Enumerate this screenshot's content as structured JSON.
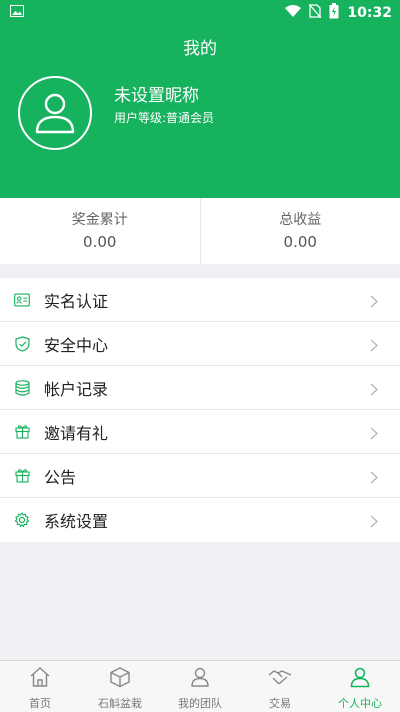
{
  "status_bar": {
    "time": "10:32"
  },
  "header": {
    "title": "我的",
    "nickname": "未设置昵称",
    "level": "用户等级:普通会员"
  },
  "stats": [
    {
      "label": "奖金累计",
      "value": "0.00"
    },
    {
      "label": "总收益",
      "value": "0.00"
    }
  ],
  "menu": [
    {
      "label": "实名认证",
      "icon": "id-card-icon"
    },
    {
      "label": "安全中心",
      "icon": "shield-icon"
    },
    {
      "label": "帐户记录",
      "icon": "database-icon"
    },
    {
      "label": "邀请有礼",
      "icon": "gift-icon"
    },
    {
      "label": "公告",
      "icon": "gift-icon"
    },
    {
      "label": "系统设置",
      "icon": "gear-icon"
    }
  ],
  "tabs": [
    {
      "label": "首页",
      "icon": "home-icon"
    },
    {
      "label": "石斛盆栽",
      "icon": "box-icon"
    },
    {
      "label": "我的团队",
      "icon": "team-icon"
    },
    {
      "label": "交易",
      "icon": "handshake-icon"
    },
    {
      "label": "个人中心",
      "icon": "user-icon",
      "active": true
    }
  ],
  "colors": {
    "accent": "#17b25e",
    "background": "#efeff4"
  }
}
